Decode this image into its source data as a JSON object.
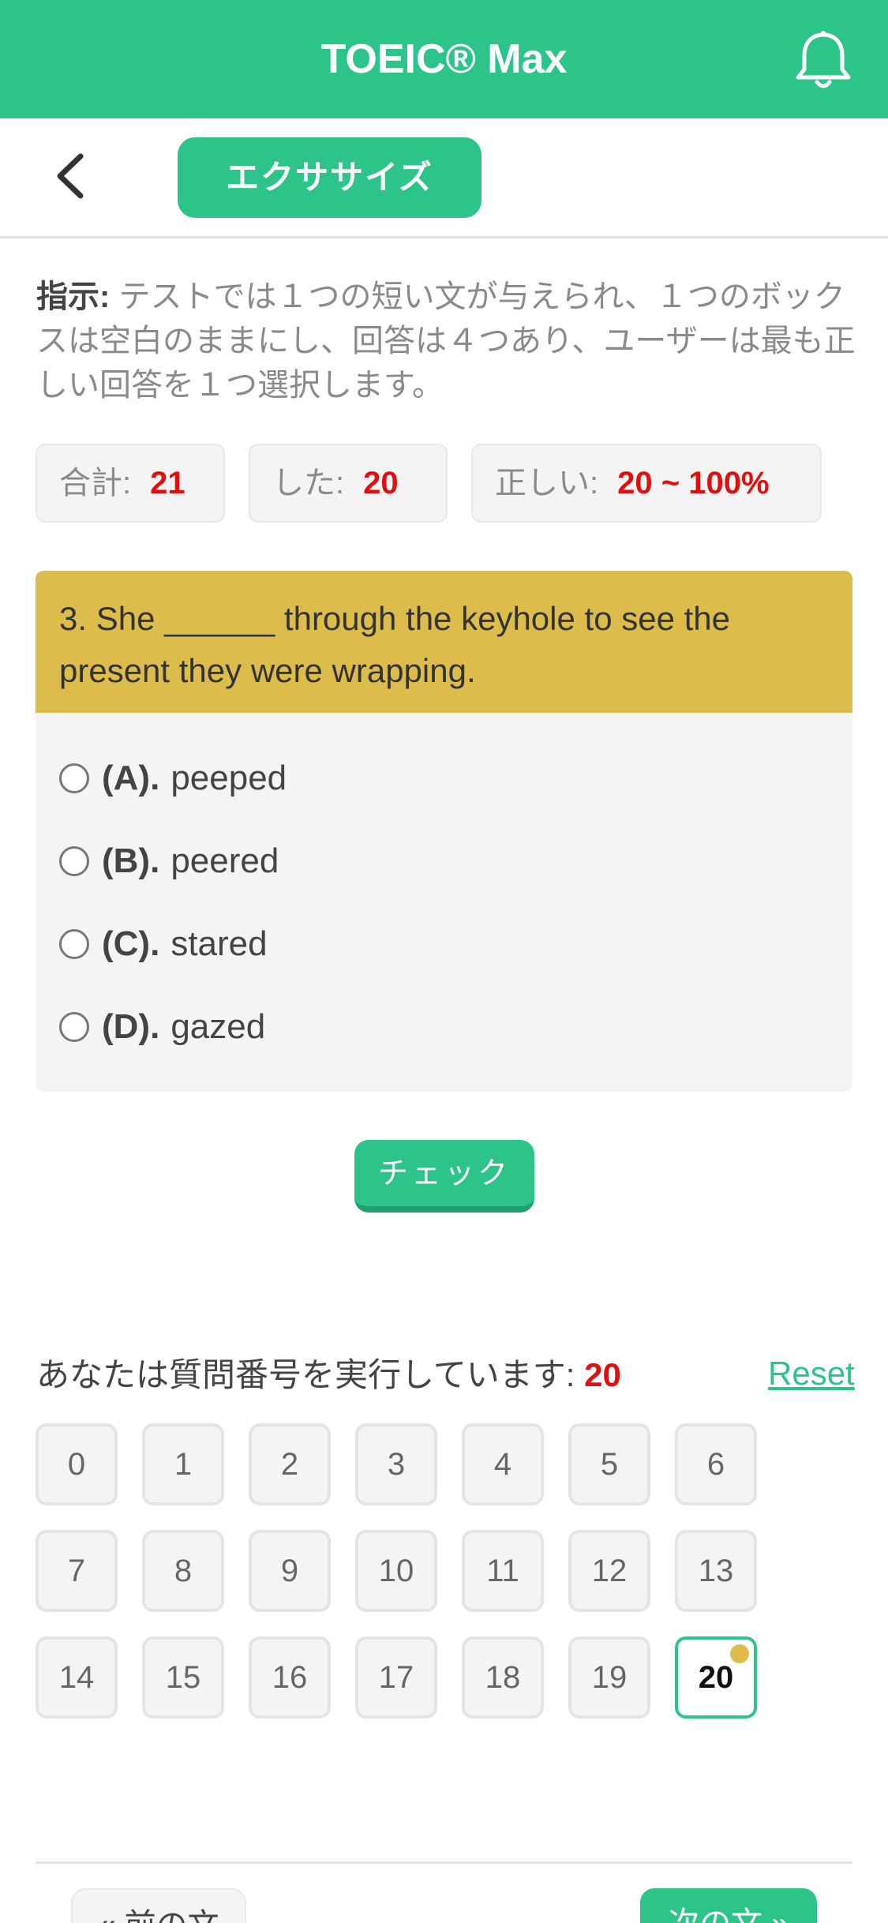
{
  "header": {
    "title": "TOEIC® Max",
    "bell_icon": "bell-icon",
    "accent_color": "#2dc48a"
  },
  "subheader": {
    "back_icon": "chevron-left-icon",
    "exercise_label": "エクササイズ"
  },
  "instructions": {
    "label": "指示:",
    "text": " テストでは１つの短い文が与えられ、１つのボックスは空白のままにし、回答は４つあり、ユーザーは最も正しい回答を１つ選択します。"
  },
  "stats": {
    "total_label": "合計:",
    "total_value": "21",
    "done_label": "した:",
    "done_value": "20",
    "correct_label": "正しい:",
    "correct_value": "20 ~ 100%"
  },
  "question": {
    "text": "3. She ______ through the keyhole to see the present they were wrapping.",
    "options": [
      {
        "letter": "(A).",
        "text": "peeped"
      },
      {
        "letter": "(B).",
        "text": "peered"
      },
      {
        "letter": "(C).",
        "text": "stared"
      },
      {
        "letter": "(D).",
        "text": "gazed"
      }
    ]
  },
  "check_label": "チェック",
  "progress": {
    "label": "あなたは質問番号を実行しています:",
    "current": "20",
    "reset_label": "Reset",
    "numbers": [
      "0",
      "1",
      "2",
      "3",
      "4",
      "5",
      "6",
      "7",
      "8",
      "9",
      "10",
      "11",
      "12",
      "13",
      "14",
      "15",
      "16",
      "17",
      "18",
      "19",
      "20"
    ]
  },
  "nav": {
    "prev_label": "« 前の文",
    "next_label": "次の文 »"
  }
}
